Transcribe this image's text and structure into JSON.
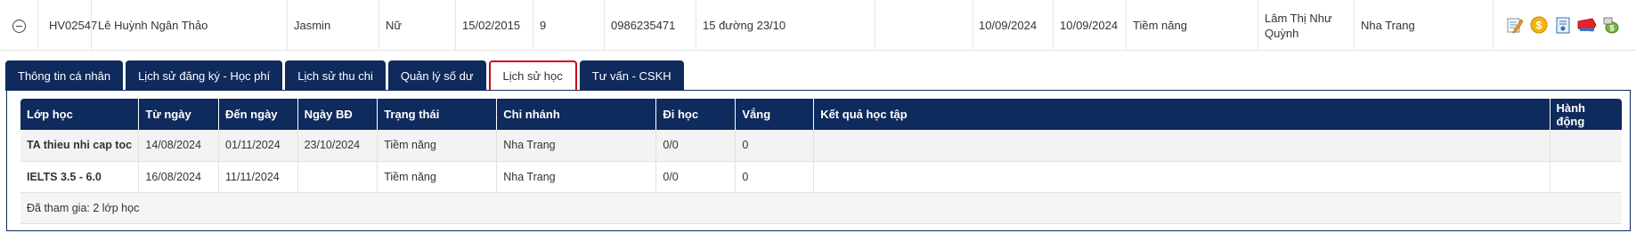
{
  "student": {
    "code": "HV02547",
    "name": "Lê Huỳnh Ngân Thảo",
    "english_name": "Jasmin",
    "gender": "Nữ",
    "birthday": "15/02/2015",
    "grade": "9",
    "phone": "0986235471",
    "address": "15 đường 23/10",
    "extra": "",
    "created_date": "10/09/2024",
    "updated_date": "10/09/2024",
    "status": "Tiềm năng",
    "consultant": "Lâm Thị Như Quỳnh",
    "branch": "Nha Trang"
  },
  "actions": [
    {
      "icon": "edit-icon"
    },
    {
      "icon": "coin-icon"
    },
    {
      "icon": "document-icon"
    },
    {
      "icon": "sale-tag-icon"
    },
    {
      "icon": "money-bag-icon"
    }
  ],
  "tabs": [
    {
      "label": "Thông tin cá nhân",
      "active": false
    },
    {
      "label": "Lịch sử đăng ký - Học phí",
      "active": false
    },
    {
      "label": "Lịch sử thu chi",
      "active": false
    },
    {
      "label": "Quản lý số dư",
      "active": false
    },
    {
      "label": "Lịch sử học",
      "active": true
    },
    {
      "label": "Tư vấn - CSKH",
      "active": false
    }
  ],
  "table": {
    "headers": [
      "Lớp học",
      "Từ ngày",
      "Đến ngày",
      "Ngày BĐ",
      "Trạng thái",
      "Chi nhánh",
      "Đi học",
      "Vắng",
      "Kết quả học tập",
      "Hành động"
    ],
    "rows": [
      [
        "TA thieu nhi cap toc",
        "14/08/2024",
        "01/11/2024",
        "23/10/2024",
        "Tiềm năng",
        "Nha Trang",
        "0/0",
        "0",
        "",
        ""
      ],
      [
        "IELTS 3.5 - 6.0",
        "16/08/2024",
        "11/11/2024",
        "",
        "Tiềm năng",
        "Nha Trang",
        "0/0",
        "0",
        "",
        ""
      ]
    ],
    "summary": "Đã tham gia: 2 lớp học"
  },
  "colors": {
    "navy": "#0f2a5c",
    "active_tab_border": "#d0021b"
  }
}
